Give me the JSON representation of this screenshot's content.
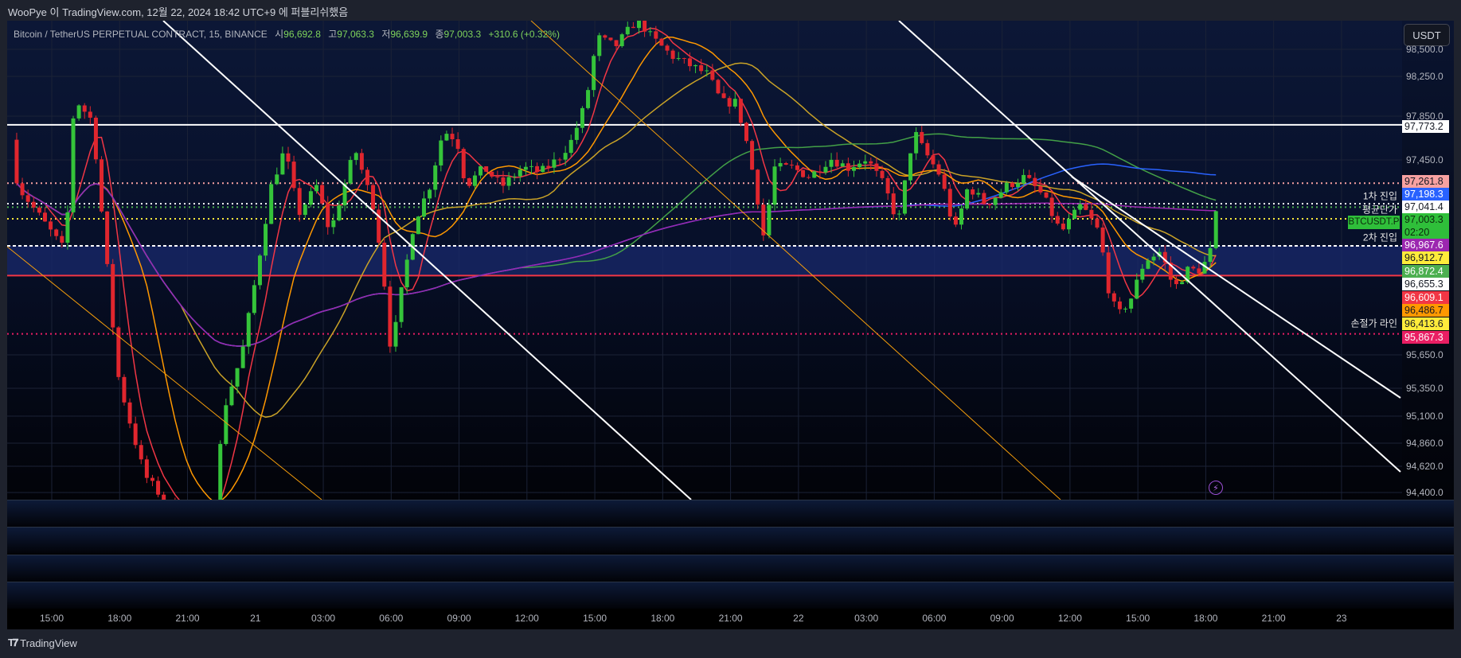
{
  "publish_line": "WooPye 이 TradingView.com, 12월 22, 2024 18:42 UTC+9 에 퍼블리쉬했음",
  "legend": {
    "symbol": "Bitcoin / TetherUS PERPETUAL CONTRACT, 15, BINANCE",
    "open_key": "시",
    "open": "96,692.8",
    "high_key": "고",
    "high": "97,063.3",
    "low_key": "저",
    "low": "96,639.9",
    "close_key": "종",
    "close": "97,003.3",
    "change": "+310.6 (+0.32%)"
  },
  "currency_button": "USDT",
  "price_ticks": [
    "98,500.0",
    "98,250.0",
    "97,850.0",
    "97,450.0",
    "95,650.0",
    "95,350.0",
    "95,100.0",
    "94,860.0",
    "94,620.0",
    "94,400.0"
  ],
  "price_labels": [
    {
      "text": "97,773.2",
      "bg": "#ffffff",
      "fg": "#131722"
    },
    {
      "text": "97,261.8",
      "bg": "#f7a1a1",
      "fg": "#131722"
    },
    {
      "text": "97,198.3",
      "bg": "#2962ff",
      "fg": "#ffffff"
    },
    {
      "text": "97,041.4",
      "bg": "#ffffff",
      "fg": "#131722"
    },
    {
      "text": "97,003.3",
      "bg": "#2fbf3a",
      "fg": "#0c2a0c",
      "sub": "02:20"
    },
    {
      "text": "96,967.6",
      "bg": "#9c27b0",
      "fg": "#ffffff"
    },
    {
      "text": "96,912.7",
      "bg": "#ffeb3b",
      "fg": "#131722"
    },
    {
      "text": "96,872.4",
      "bg": "#4caf50",
      "fg": "#ffffff"
    },
    {
      "text": "96,655.3",
      "bg": "#ffffff",
      "fg": "#131722"
    },
    {
      "text": "96,609.1",
      "bg": "#f23645",
      "fg": "#ffffff"
    },
    {
      "text": "96,486.7",
      "bg": "#ff9800",
      "fg": "#131722"
    },
    {
      "text": "96,413.6",
      "bg": "#ffeb3b",
      "fg": "#131722"
    },
    {
      "text": "95,867.3",
      "bg": "#e91e63",
      "fg": "#ffffff"
    }
  ],
  "line_labels": {
    "entry1": "1차 진입",
    "avg_price": "평균단가",
    "symbol_tag": "BTCUSDT.P",
    "entry2": "2차 진입",
    "stop_loss": "손절가 라인"
  },
  "time_labels": [
    "15:00",
    "18:00",
    "21:00",
    "21",
    "03:00",
    "06:00",
    "09:00",
    "12:00",
    "15:00",
    "18:00",
    "21:00",
    "22",
    "03:00",
    "06:00",
    "09:00",
    "12:00",
    "15:00",
    "18:00",
    "21:00",
    "23"
  ],
  "brand": "TradingView",
  "colors": {
    "up": "#35c43a",
    "down": "#e0262e",
    "bg_top": "#0c1736"
  },
  "chart_data": {
    "type": "candlestick",
    "interval_minutes": 15,
    "time_unit": "hours since 20 Dec 15:00",
    "ylim": [
      94400,
      98600
    ],
    "price_path": [
      [
        -1.8,
        97664
      ],
      [
        -1.5,
        97234
      ],
      [
        -0.6,
        96975
      ],
      [
        0.6,
        96630
      ],
      [
        1.0,
        98050
      ],
      [
        1.8,
        97836
      ],
      [
        2.5,
        96372
      ],
      [
        2.9,
        95510
      ],
      [
        3.3,
        95167
      ],
      [
        4.1,
        94560
      ],
      [
        4.9,
        94350
      ],
      [
        6.0,
        94130
      ],
      [
        7.2,
        94260
      ],
      [
        7.6,
        95167
      ],
      [
        8.4,
        95680
      ],
      [
        9.0,
        96370
      ],
      [
        9.7,
        97234
      ],
      [
        10.3,
        97578
      ],
      [
        10.9,
        96975
      ],
      [
        11.7,
        97234
      ],
      [
        12.3,
        96800
      ],
      [
        13.4,
        97578
      ],
      [
        14.2,
        97060
      ],
      [
        14.6,
        96545
      ],
      [
        15.0,
        95680
      ],
      [
        15.4,
        96200
      ],
      [
        16.0,
        96890
      ],
      [
        16.7,
        97234
      ],
      [
        17.3,
        97750
      ],
      [
        17.9,
        97664
      ],
      [
        18.3,
        97234
      ],
      [
        19.1,
        97406
      ],
      [
        19.9,
        97234
      ],
      [
        20.8,
        97406
      ],
      [
        21.6,
        97363
      ],
      [
        22.4,
        97492
      ],
      [
        23.0,
        97664
      ],
      [
        23.6,
        98009
      ],
      [
        24.1,
        98612
      ],
      [
        24.9,
        98526
      ],
      [
        25.9,
        98784
      ],
      [
        26.5,
        98612
      ],
      [
        27.4,
        98440
      ],
      [
        28.2,
        98353
      ],
      [
        29.0,
        98267
      ],
      [
        29.6,
        98009
      ],
      [
        30.2,
        98009
      ],
      [
        30.6,
        97750
      ],
      [
        31.1,
        97234
      ],
      [
        31.5,
        96717
      ],
      [
        31.9,
        97406
      ],
      [
        32.7,
        97406
      ],
      [
        33.5,
        97320
      ],
      [
        34.4,
        97492
      ],
      [
        35.2,
        97406
      ],
      [
        36.0,
        97492
      ],
      [
        36.8,
        97234
      ],
      [
        37.4,
        96890
      ],
      [
        38.1,
        97750
      ],
      [
        38.5,
        97578
      ],
      [
        39.3,
        97320
      ],
      [
        39.9,
        96803
      ],
      [
        40.5,
        97234
      ],
      [
        41.3,
        97062
      ],
      [
        42.2,
        97234
      ],
      [
        43.0,
        97320
      ],
      [
        43.8,
        97148
      ],
      [
        44.6,
        96803
      ],
      [
        45.5,
        97062
      ],
      [
        46.3,
        96803
      ],
      [
        46.7,
        96286
      ],
      [
        47.1,
        96028
      ],
      [
        47.7,
        96200
      ],
      [
        48.3,
        96545
      ],
      [
        49.0,
        96631
      ],
      [
        49.6,
        96286
      ],
      [
        50.2,
        96458
      ],
      [
        50.8,
        96458
      ],
      [
        51.2,
        96631
      ],
      [
        51.5,
        97003.3
      ]
    ],
    "moving_averages": [
      {
        "period": 6,
        "color": "#f23645"
      },
      {
        "period": 14,
        "color": "#ff9800"
      },
      {
        "period": 30,
        "color": "#c9a227"
      },
      {
        "period": 90,
        "color": "#43a047"
      },
      {
        "period": 150,
        "color": "#2962ff"
      },
      {
        "period": 260,
        "color": "#9c27b0"
      }
    ],
    "horizontal_lines": [
      {
        "price": 97802,
        "color": "#ffffff",
        "style": "solid"
      },
      {
        "price": 97261.8,
        "color": "#f7a1a1",
        "style": "dotted"
      },
      {
        "price": 97072,
        "color": "#ffffff",
        "style": "dotted"
      },
      {
        "price": 97040,
        "color": "#4caf50",
        "style": "dotted"
      },
      {
        "price": 96932,
        "color": "#ffeb3b",
        "style": "dotted"
      },
      {
        "price": 96682,
        "color": "#ffffff",
        "style": "dashed"
      },
      {
        "price": 96407,
        "color": "#f23645",
        "style": "solid"
      },
      {
        "price": 95867.3,
        "color": "#e91e63",
        "style": "dotted"
      }
    ],
    "band": {
      "from": 96682,
      "to": 96407,
      "color": "#1a2a6c"
    }
  }
}
